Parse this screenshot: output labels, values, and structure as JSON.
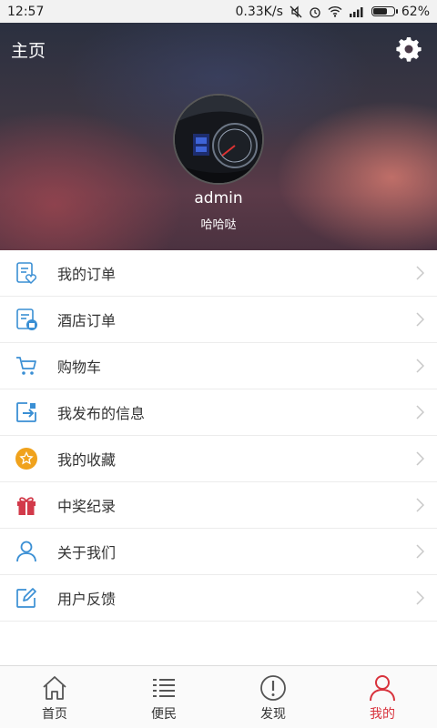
{
  "status_bar": {
    "time": "12:57",
    "speed": "0.33K/s",
    "battery": "62%"
  },
  "header": {
    "title": "主页",
    "username": "admin",
    "subtitle": "哈哈哒"
  },
  "menu": {
    "items": [
      {
        "label": "我的订单",
        "icon": "order-heart-icon"
      },
      {
        "label": "酒店订单",
        "icon": "hotel-order-icon"
      },
      {
        "label": "购物车",
        "icon": "cart-icon"
      },
      {
        "label": "我发布的信息",
        "icon": "publish-icon"
      },
      {
        "label": "我的收藏",
        "icon": "star-icon"
      },
      {
        "label": "中奖纪录",
        "icon": "gift-icon"
      },
      {
        "label": "关于我们",
        "icon": "person-icon"
      },
      {
        "label": "用户反馈",
        "icon": "edit-icon"
      }
    ]
  },
  "tabs": [
    {
      "label": "首页",
      "icon": "home-icon"
    },
    {
      "label": "便民",
      "icon": "list-icon"
    },
    {
      "label": "发现",
      "icon": "exclamation-icon"
    },
    {
      "label": "我的",
      "icon": "profile-icon",
      "active": true
    }
  ],
  "colors": {
    "accent_blue": "#3a8fd4",
    "active_red": "#d8323c",
    "star_orange": "#f0a21c",
    "gift_red": "#d23a4a"
  }
}
